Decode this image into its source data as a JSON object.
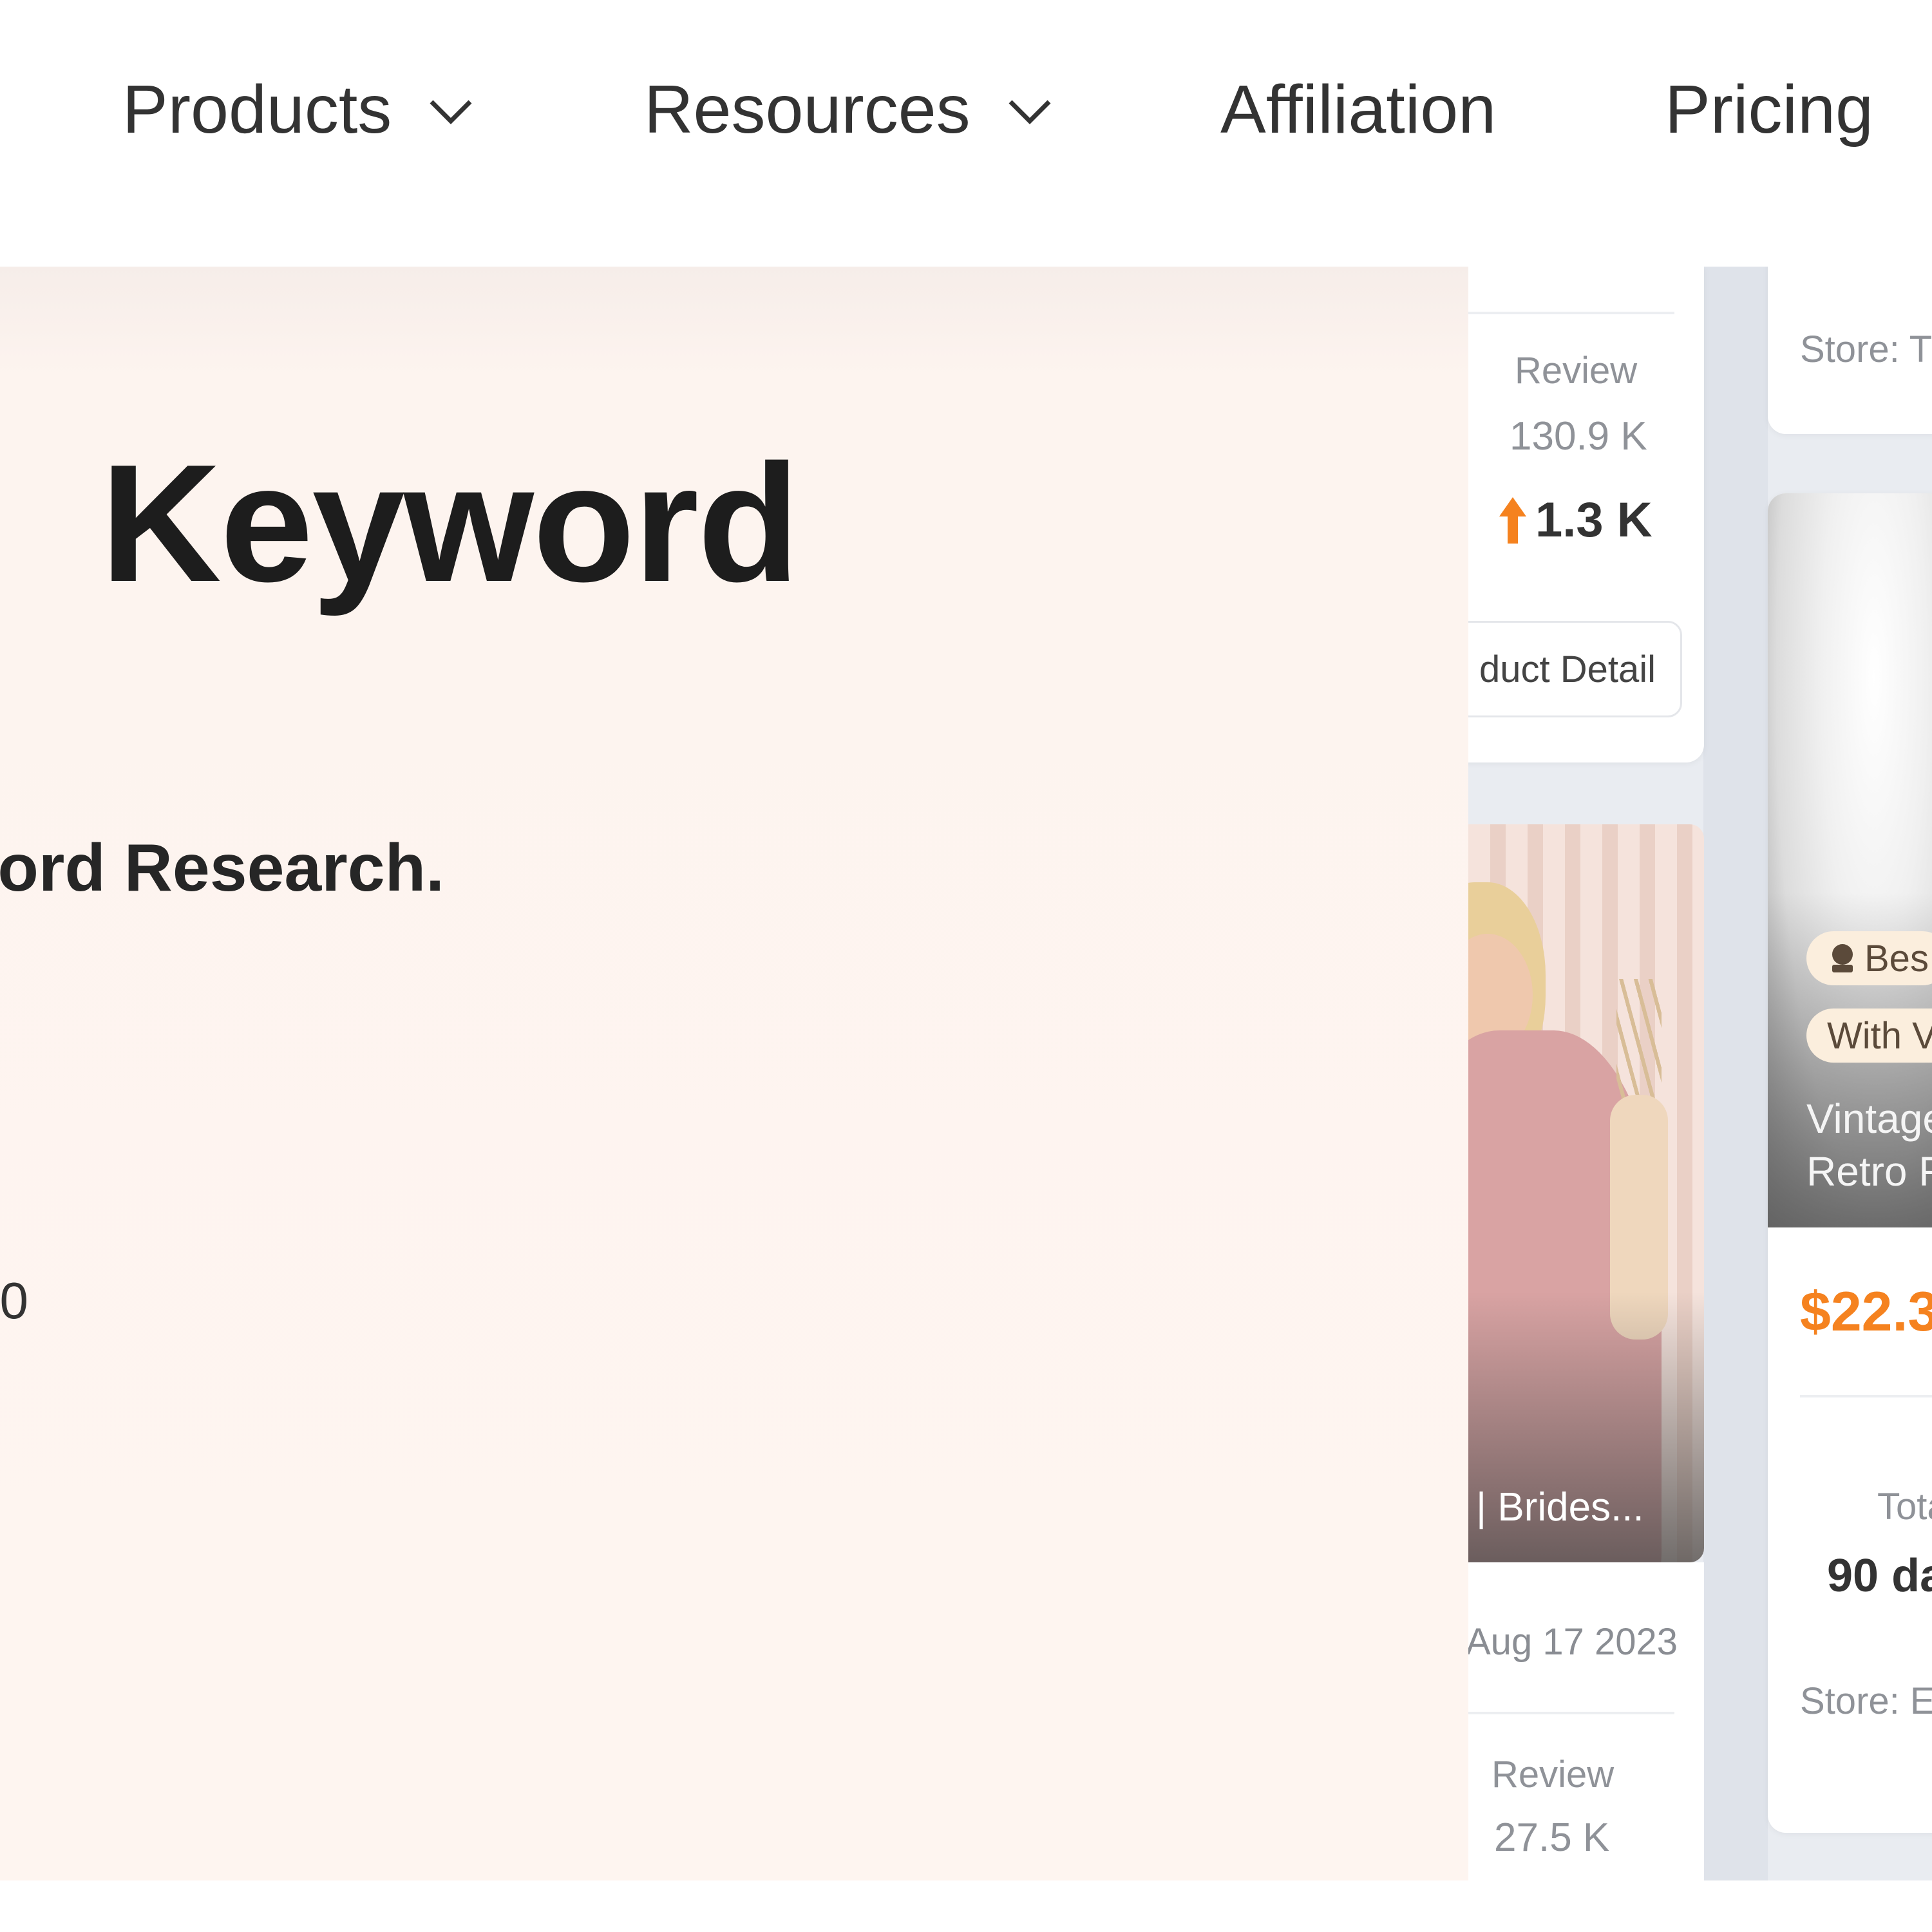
{
  "nav": {
    "products": "Products",
    "resources": "Resources",
    "affiliation": "Affiliation",
    "pricing": "Pricing"
  },
  "hero": {
    "title_fragment": "Keyword",
    "subtitle_fragment": "ord Research.",
    "text_fragment": "0"
  },
  "showcase": {
    "card1": {
      "review_label": "Review",
      "review_value": "130.9 K",
      "growth": "1.3 K",
      "button": "duct Detail"
    },
    "card2": {
      "image_caption": "| Brides...",
      "date": "Aug 17 2023",
      "review_label": "Review",
      "review_value": "27.5 K"
    },
    "card3": {
      "store_top": "Store: T",
      "badge_best": "Bes",
      "badge_with": "With V",
      "title_line1": "Vintage",
      "title_line2": "Retro F",
      "price": "$22.3",
      "total_label": "Tota",
      "period": "90 da",
      "store_bottom": "Store: E"
    }
  },
  "colors": {
    "accent_orange": "#f5821f",
    "hero_bg": "#fef5f0",
    "showcase_bg": "#e9ecf1"
  }
}
